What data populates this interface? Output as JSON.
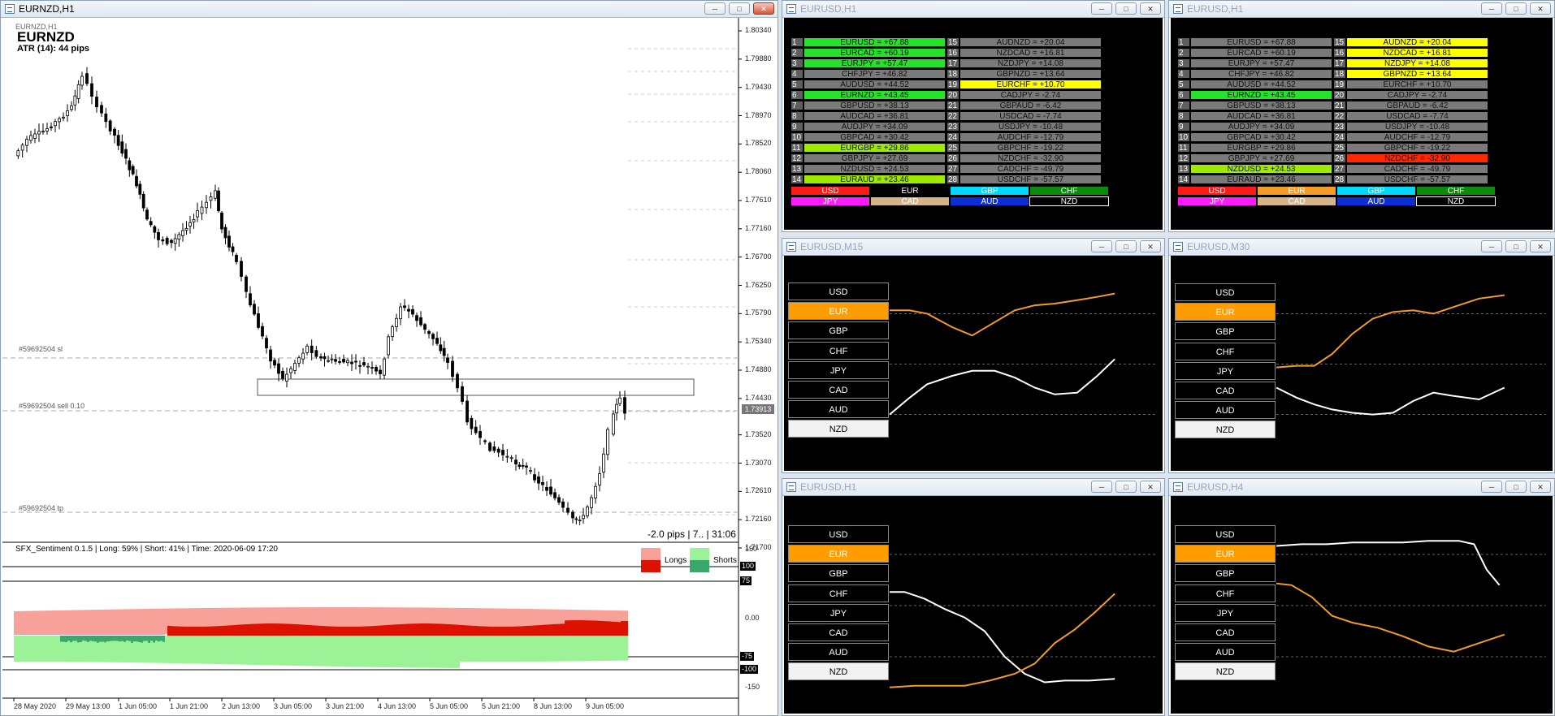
{
  "colors": {
    "orange": "#f49b28",
    "white": "#ffffff",
    "bull": "#1a1a1a",
    "long_light": "#f7a199",
    "long_dark": "#dd1100",
    "short_light": "#9cf296",
    "short_dark": "#3aa86a"
  },
  "main": {
    "title": "EURNZD,H1",
    "inner_title": "EURNZD,H1",
    "symbol": "EURNZD",
    "atr": "ATR (14): 44 pips",
    "order_sl": "#59692504 sl",
    "order_sell": "#59692504 sell 0.10",
    "order_tp": "#59692504 tp",
    "pips": "-2.0 pips | 7.. | 31:06",
    "price_labels": [
      "1.80340",
      "1.79880",
      "1.79430",
      "1.78970",
      "1.78520",
      "1.78060",
      "1.77610",
      "1.77160",
      "1.76700",
      "1.76250",
      "1.75790",
      "1.75340",
      "1.74880",
      "1.74430",
      "1.73520",
      "1.73070",
      "1.72610",
      "1.72160",
      "1.71700"
    ],
    "current_price": "1.73913",
    "indicator_title": "SFX_Sentiment 0.1.5 | Long: 59% | Short: 41% | Time: 2020-06-09 17:20",
    "longs_label": "Longs",
    "shorts_label": "Shorts",
    "ind_scale": [
      "150",
      "100",
      "75",
      "0.00",
      "-75",
      "-100",
      "-150"
    ],
    "time_labels": [
      "28 May 2020",
      "29 May 13:00",
      "1 Jun 05:00",
      "1 Jun 21:00",
      "2 Jun 13:00",
      "3 Jun 05:00",
      "3 Jun 21:00",
      "4 Jun 13:00",
      "5 Jun 05:00",
      "5 Jun 21:00",
      "8 Jun 13:00",
      "9 Jun 05:00"
    ]
  },
  "tables": [
    {
      "title": "EURUSD,H1",
      "rows": [
        {
          "n": "1",
          "v": "EURUSD = +67.88",
          "c": "grn",
          "n2": "15",
          "v2": "AUDNZD = +20.04",
          "c2": "g"
        },
        {
          "n": "2",
          "v": "EURCAD = +60.19",
          "c": "grn",
          "n2": "16",
          "v2": "NZDCAD = +16.81",
          "c2": "g"
        },
        {
          "n": "3",
          "v": "EURJPY = +57.47",
          "c": "grn",
          "n2": "17",
          "v2": "NZDJPY = +14.08",
          "c2": "g"
        },
        {
          "n": "4",
          "v": "CHFJPY = +46.82",
          "c": "g",
          "n2": "18",
          "v2": "GBPNZD = +13.64",
          "c2": "g"
        },
        {
          "n": "5",
          "v": "AUDUSD = +44.52",
          "c": "g",
          "n2": "19",
          "v2": "EURCHF = +10.70",
          "c2": "ylw"
        },
        {
          "n": "6",
          "v": "EURNZD = +43.45",
          "c": "grn",
          "n2": "20",
          "v2": "CADJPY = -2.74",
          "c2": "g"
        },
        {
          "n": "7",
          "v": "GBPUSD = +38.13",
          "c": "g",
          "n2": "21",
          "v2": "GBPAUD = -6.42",
          "c2": "g"
        },
        {
          "n": "8",
          "v": "AUDCAD = +36.81",
          "c": "g",
          "n2": "22",
          "v2": "USDCAD = -7.74",
          "c2": "g"
        },
        {
          "n": "9",
          "v": "AUDJPY = +34.09",
          "c": "g",
          "n2": "23",
          "v2": "USDJPY = -10.48",
          "c2": "g"
        },
        {
          "n": "10",
          "v": "GBPCAD = +30.42",
          "c": "g",
          "n2": "24",
          "v2": "AUDCHF = -12.79",
          "c2": "g"
        },
        {
          "n": "11",
          "v": "EURGBP = +29.86",
          "c": "lgrn",
          "n2": "25",
          "v2": "GBPCHF = -19.22",
          "c2": "g"
        },
        {
          "n": "12",
          "v": "GBPJPY = +27.69",
          "c": "g",
          "n2": "26",
          "v2": "NZDCHF = -32.90",
          "c2": "g"
        },
        {
          "n": "13",
          "v": "NZDUSD = +24.53",
          "c": "g",
          "n2": "27",
          "v2": "CADCHF = -49.79",
          "c2": "g"
        },
        {
          "n": "14",
          "v": "EURAUD = +23.46",
          "c": "lgrn",
          "n2": "28",
          "v2": "USDCHF = -57.57",
          "c2": "g"
        }
      ]
    },
    {
      "title": "EURUSD,H1",
      "rows": [
        {
          "n": "1",
          "v": "EURUSD = +67.88",
          "c": "g",
          "n2": "15",
          "v2": "AUDNZD = +20.04",
          "c2": "ylw"
        },
        {
          "n": "2",
          "v": "EURCAD = +60.19",
          "c": "g",
          "n2": "16",
          "v2": "NZDCAD = +16.81",
          "c2": "ylw"
        },
        {
          "n": "3",
          "v": "EURJPY = +57.47",
          "c": "g",
          "n2": "17",
          "v2": "NZDJPY = +14.08",
          "c2": "ylw"
        },
        {
          "n": "4",
          "v": "CHFJPY = +46.82",
          "c": "g",
          "n2": "18",
          "v2": "GBPNZD = +13.64",
          "c2": "ylw"
        },
        {
          "n": "5",
          "v": "AUDUSD = +44.52",
          "c": "g",
          "n2": "19",
          "v2": "EURCHF = +10.70",
          "c2": "g"
        },
        {
          "n": "6",
          "v": "EURNZD = +43.45",
          "c": "grn",
          "n2": "20",
          "v2": "CADJPY = -2.74",
          "c2": "g"
        },
        {
          "n": "7",
          "v": "GBPUSD = +38.13",
          "c": "g",
          "n2": "21",
          "v2": "GBPAUD = -6.42",
          "c2": "g"
        },
        {
          "n": "8",
          "v": "AUDCAD = +36.81",
          "c": "g",
          "n2": "22",
          "v2": "USDCAD = -7.74",
          "c2": "g"
        },
        {
          "n": "9",
          "v": "AUDJPY = +34.09",
          "c": "g",
          "n2": "23",
          "v2": "USDJPY = -10.48",
          "c2": "g"
        },
        {
          "n": "10",
          "v": "GBPCAD = +30.42",
          "c": "g",
          "n2": "24",
          "v2": "AUDCHF = -12.79",
          "c2": "g"
        },
        {
          "n": "11",
          "v": "EURGBP = +29.86",
          "c": "g",
          "n2": "25",
          "v2": "GBPCHF = -19.22",
          "c2": "g"
        },
        {
          "n": "12",
          "v": "GBPJPY = +27.69",
          "c": "g",
          "n2": "26",
          "v2": "NZDCHF = -32.90",
          "c2": "red"
        },
        {
          "n": "13",
          "v": "NZDUSD = +24.53",
          "c": "lgrn",
          "n2": "27",
          "v2": "CADCHF = -49.79",
          "c2": "g"
        },
        {
          "n": "14",
          "v": "EURAUD = +23.46",
          "c": "g",
          "n2": "28",
          "v2": "USDCHF = -57.57",
          "c2": "g"
        }
      ]
    }
  ],
  "legend": [
    {
      "label": "USD",
      "bg": "#ff1a1a",
      "fg": "#ffffff"
    },
    {
      "label": "EUR",
      "bg": "#000000",
      "fg": "#ffffff"
    },
    {
      "label": "GBP",
      "bg": "#00d8ff",
      "fg": "#ffffff"
    },
    {
      "label": "CHF",
      "bg": "#0c8a0c",
      "fg": "#ffffff"
    },
    {
      "label": "JPY",
      "bg": "#ff1aff",
      "fg": "#ffffff"
    },
    {
      "label": "CAD",
      "bg": "#d6b48a",
      "fg": "#ffffff"
    },
    {
      "label": "AUD",
      "bg": "#0b2ed6",
      "fg": "#ffffff"
    },
    {
      "label": "NZD",
      "bg": "#000000",
      "fg": "#ffffff"
    }
  ],
  "legend2_eur_bg": "#f49b28",
  "currencies": [
    "USD",
    "EUR",
    "GBP",
    "CHF",
    "JPY",
    "CAD",
    "AUD",
    "NZD"
  ],
  "strength": [
    {
      "title": "EURUSD,M15",
      "orange": [
        [
          0,
          0.82
        ],
        [
          0.08,
          0.82
        ],
        [
          0.15,
          0.8
        ],
        [
          0.25,
          0.72
        ],
        [
          0.33,
          0.67
        ],
        [
          0.42,
          0.75
        ],
        [
          0.5,
          0.82
        ],
        [
          0.58,
          0.85
        ],
        [
          0.66,
          0.86
        ],
        [
          0.75,
          0.88
        ],
        [
          0.83,
          0.9
        ],
        [
          0.9,
          0.92
        ]
      ],
      "white": [
        [
          0,
          0.2
        ],
        [
          0.08,
          0.3
        ],
        [
          0.15,
          0.38
        ],
        [
          0.25,
          0.43
        ],
        [
          0.33,
          0.46
        ],
        [
          0.42,
          0.46
        ],
        [
          0.5,
          0.42
        ],
        [
          0.58,
          0.36
        ],
        [
          0.66,
          0.32
        ],
        [
          0.75,
          0.33
        ],
        [
          0.83,
          0.43
        ],
        [
          0.9,
          0.53
        ]
      ]
    },
    {
      "title": "EURUSD,M30",
      "orange": [
        [
          0,
          0.48
        ],
        [
          0.08,
          0.49
        ],
        [
          0.15,
          0.49
        ],
        [
          0.22,
          0.56
        ],
        [
          0.3,
          0.68
        ],
        [
          0.38,
          0.77
        ],
        [
          0.46,
          0.81
        ],
        [
          0.54,
          0.82
        ],
        [
          0.62,
          0.8
        ],
        [
          0.7,
          0.84
        ],
        [
          0.8,
          0.89
        ],
        [
          0.9,
          0.91
        ]
      ],
      "white": [
        [
          0,
          0.36
        ],
        [
          0.08,
          0.3
        ],
        [
          0.15,
          0.26
        ],
        [
          0.22,
          0.23
        ],
        [
          0.3,
          0.21
        ],
        [
          0.38,
          0.2
        ],
        [
          0.46,
          0.21
        ],
        [
          0.54,
          0.28
        ],
        [
          0.62,
          0.33
        ],
        [
          0.7,
          0.31
        ],
        [
          0.8,
          0.29
        ],
        [
          0.9,
          0.36
        ]
      ]
    },
    {
      "title": "EURUSD,H1",
      "orange": [
        [
          0,
          0.02
        ],
        [
          0.1,
          0.03
        ],
        [
          0.2,
          0.03
        ],
        [
          0.3,
          0.03
        ],
        [
          0.4,
          0.06
        ],
        [
          0.5,
          0.1
        ],
        [
          0.58,
          0.16
        ],
        [
          0.66,
          0.28
        ],
        [
          0.74,
          0.36
        ],
        [
          0.82,
          0.46
        ],
        [
          0.9,
          0.57
        ]
      ],
      "white": [
        [
          0,
          0.58
        ],
        [
          0.06,
          0.58
        ],
        [
          0.14,
          0.54
        ],
        [
          0.22,
          0.48
        ],
        [
          0.3,
          0.43
        ],
        [
          0.38,
          0.35
        ],
        [
          0.46,
          0.2
        ],
        [
          0.54,
          0.1
        ],
        [
          0.62,
          0.05
        ],
        [
          0.7,
          0.06
        ],
        [
          0.8,
          0.06
        ],
        [
          0.9,
          0.07
        ]
      ]
    },
    {
      "title": "EURUSD,H4",
      "orange": [
        [
          0,
          0.63
        ],
        [
          0.06,
          0.62
        ],
        [
          0.14,
          0.55
        ],
        [
          0.22,
          0.44
        ],
        [
          0.3,
          0.4
        ],
        [
          0.4,
          0.37
        ],
        [
          0.5,
          0.32
        ],
        [
          0.6,
          0.26
        ],
        [
          0.7,
          0.23
        ],
        [
          0.8,
          0.28
        ],
        [
          0.9,
          0.33
        ]
      ],
      "white": [
        [
          0,
          0.85
        ],
        [
          0.1,
          0.86
        ],
        [
          0.2,
          0.86
        ],
        [
          0.3,
          0.87
        ],
        [
          0.4,
          0.87
        ],
        [
          0.5,
          0.87
        ],
        [
          0.6,
          0.88
        ],
        [
          0.72,
          0.88
        ],
        [
          0.78,
          0.86
        ],
        [
          0.83,
          0.71
        ],
        [
          0.88,
          0.62
        ]
      ]
    }
  ],
  "selected_index": 1
}
